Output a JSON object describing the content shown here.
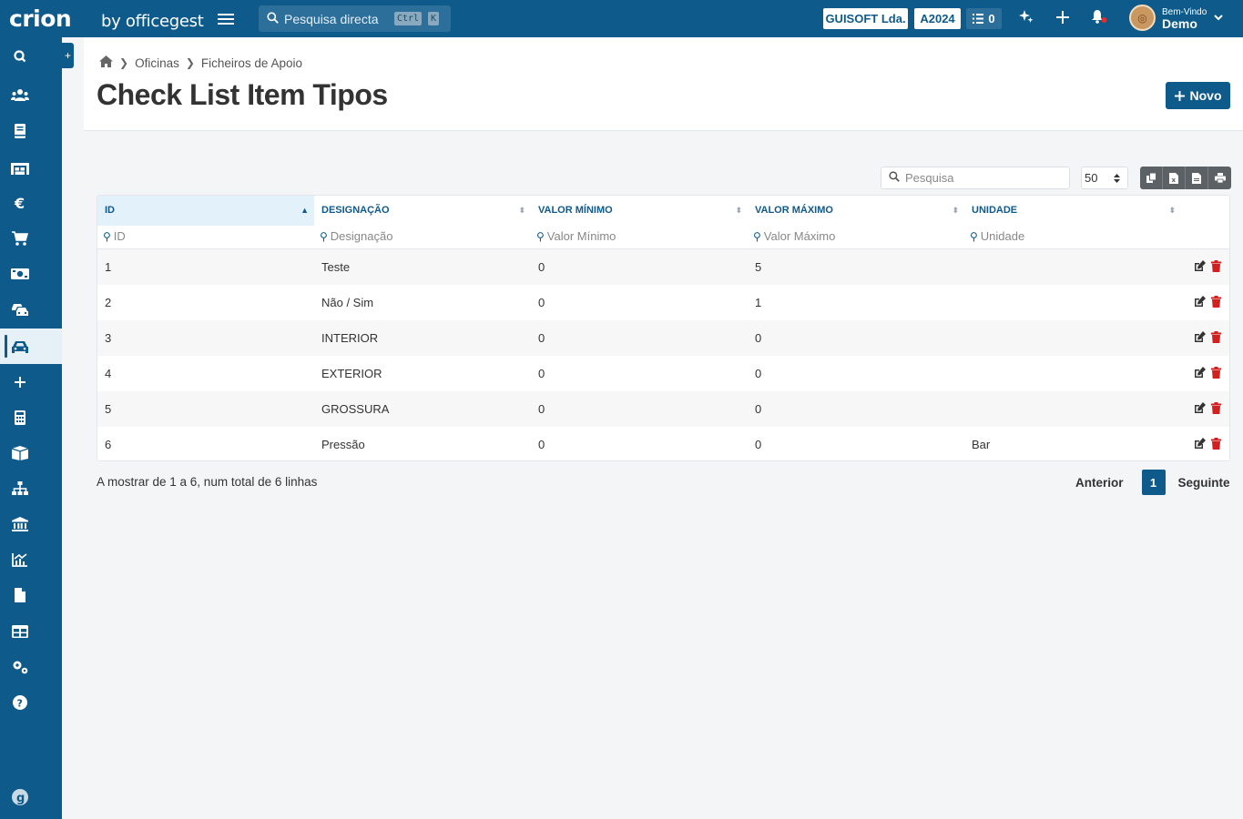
{
  "brand": {
    "logo": "crion",
    "by": "by officegest"
  },
  "topbar": {
    "search_placeholder": "Pesquisa directa",
    "kbd1": "Ctrl",
    "kbd2": "K",
    "company": "GUISOFT Lda.",
    "year": "A2024",
    "tasks_count": "0",
    "user_greeting": "Bem-Vindo",
    "user_name": "Demo"
  },
  "sidebar": {
    "items": [
      "search",
      "users",
      "book",
      "inventory",
      "euro",
      "cart",
      "money",
      "vehicles",
      "workshop",
      "plus",
      "calculator",
      "boxes",
      "hierarchy",
      "bank",
      "chart",
      "file",
      "table",
      "settings",
      "help"
    ],
    "active": "workshop",
    "bottom": "g"
  },
  "breadcrumb": {
    "item1": "Oficinas",
    "item2": "Ficheiros de Apoio"
  },
  "page": {
    "title": "Check List Item Tipos",
    "new_button": "Novo"
  },
  "toolbar": {
    "search_placeholder": "Pesquisa",
    "page_size": "50"
  },
  "table": {
    "columns": [
      "ID",
      "DESIGNAÇÃO",
      "VALOR MÍNIMO",
      "VALOR MÁXIMO",
      "UNIDADE"
    ],
    "filters": [
      "ID",
      "Designação",
      "Valor Mínimo",
      "Valor Máximo",
      "Unidade"
    ],
    "rows": [
      [
        "1",
        "Teste",
        "0",
        "5",
        ""
      ],
      [
        "2",
        "Não / Sim",
        "0",
        "1",
        ""
      ],
      [
        "3",
        "INTERIOR",
        "0",
        "0",
        ""
      ],
      [
        "4",
        "EXTERIOR",
        "0",
        "0",
        ""
      ],
      [
        "5",
        "GROSSURA",
        "0",
        "0",
        ""
      ],
      [
        "6",
        "Pressão",
        "0",
        "0",
        "Bar"
      ]
    ]
  },
  "footer": {
    "info": "A mostrar de 1 a 6, num total de 6 linhas",
    "prev": "Anterior",
    "page": "1",
    "next": "Seguinte"
  }
}
